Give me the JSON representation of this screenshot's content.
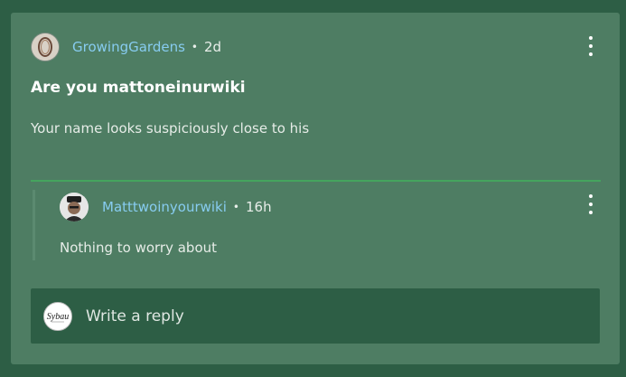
{
  "post": {
    "author": "GrowingGardens",
    "separator": "•",
    "time": "2d",
    "title": "Are you mattoneinurwiki",
    "body": "Your name looks suspiciously close to his"
  },
  "reply": {
    "author": "Matttwoinyourwiki",
    "separator": "•",
    "time": "16h",
    "body": "Nothing to worry about"
  },
  "composer": {
    "avatar_text": "Sybau",
    "placeholder": "Write a reply"
  },
  "colors": {
    "page_background": "#2d5e45",
    "card_background": "#4e7d63",
    "username": "#87ccf0",
    "separator_line": "#45a45e"
  },
  "icons": {
    "menu": "more-vertical-icon"
  }
}
